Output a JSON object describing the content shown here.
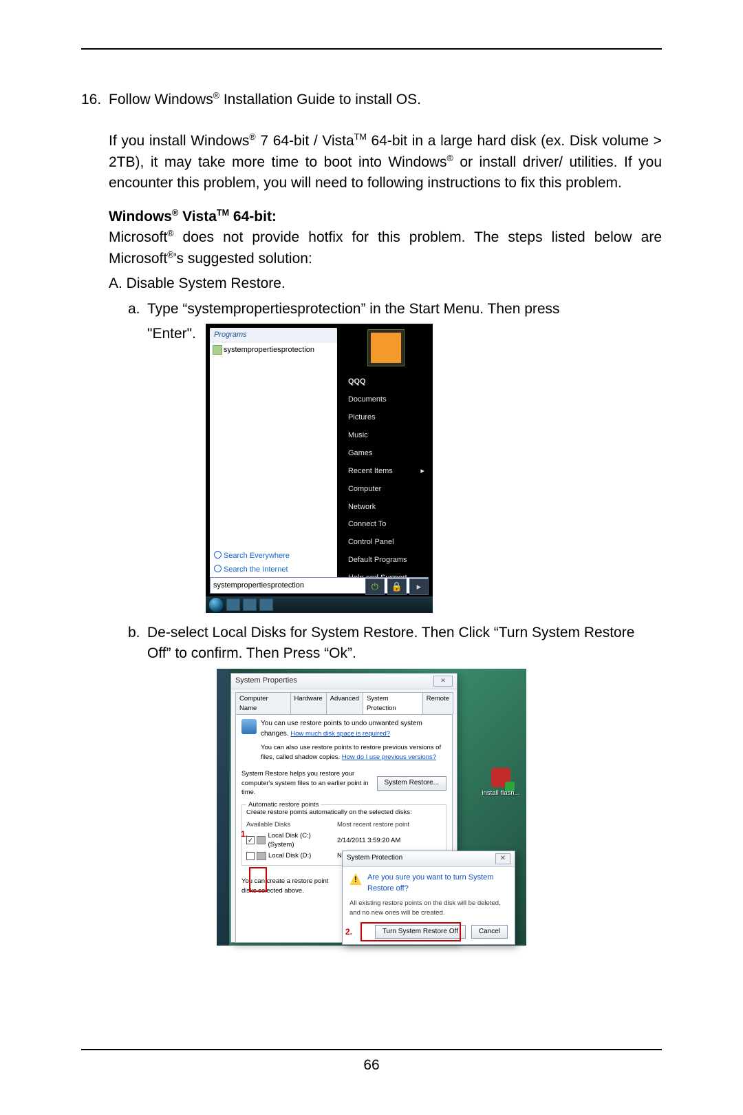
{
  "page_number": "66",
  "step16": {
    "num": "16.",
    "text_parts": [
      "Follow Windows",
      " Installation Guide to install OS."
    ]
  },
  "intro_parts": [
    "If you install Windows",
    " 7 64-bit / Vista",
    " 64-bit in a large hard disk (ex. Disk volume > 2TB), it may take more time to boot into Windows",
    " or install driver/ utilities. If you encounter this problem, you will need to following instructions to fix this problem."
  ],
  "vista_heading_parts": [
    "Windows",
    " Vista",
    " 64-bit:"
  ],
  "vista_body_parts": [
    "Microsoft",
    " does not provide hotfix for this problem. The steps listed below are Microsoft",
    "'s suggested solution:"
  ],
  "stepA": "A. Disable System Restore.",
  "step_a": {
    "lbl": "a.",
    "text": "Type “systempropertiesprotection” in the Start Menu. Then press",
    "tail": "\"Enter\"."
  },
  "step_b": {
    "lbl": "b.",
    "text": "De-select Local Disks for System Restore. Then Click “Turn System Restore Off” to confirm. Then Press “Ok”."
  },
  "fig1": {
    "programs_header": "Programs",
    "program_item": "systempropertiesprotection",
    "search_everywhere": "Search Everywhere",
    "search_internet": "Search the Internet",
    "user": "QQQ",
    "menu": [
      "Documents",
      "Pictures",
      "Music",
      "Games",
      "Recent Items",
      "Computer",
      "Network",
      "Connect To",
      "Control Panel",
      "Default Programs",
      "Help and Support"
    ],
    "search_value": "systempropertiesprotection",
    "close_x": "×",
    "power": "⏻",
    "lock": "🔒",
    "arrow": "▸"
  },
  "fig2": {
    "title": "System Properties",
    "close": "✕",
    "tabs": [
      "Computer Name",
      "Hardware",
      "Advanced",
      "System Protection",
      "Remote"
    ],
    "info1": "You can use restore points to undo unwanted system changes.",
    "info1_link": "How much disk space is required?",
    "info2": "You can also use restore points to restore previous versions of files, called shadow copies.",
    "info2_link": "How do I use previous versions?",
    "restore_help": "System Restore helps you restore your computer's system files to an earlier point in time.",
    "restore_btn": "System Restore...",
    "group_legend": "Automatic restore points",
    "group_desc": "Create restore points automatically on the selected disks:",
    "col1": "Available Disks",
    "col2": "Most recent restore point",
    "disks": [
      {
        "checked": true,
        "name": "Local Disk (C:) (System)",
        "recent": "2/14/2011 3:59:20 AM"
      },
      {
        "checked": false,
        "name": "Local Disk (D:)",
        "recent": "None"
      }
    ],
    "num1": "1.",
    "create_note": "You can create a restore point disks selected above.",
    "install_label": "install flash...",
    "popover": {
      "title": "System Protection",
      "question": "Are you sure you want to turn System Restore off?",
      "note": "All existing restore points on the disk will be deleted, and no new ones will be created.",
      "num2": "2.",
      "btn_off": "Turn System Restore Off",
      "btn_cancel": "Cancel",
      "close": "✕"
    }
  }
}
